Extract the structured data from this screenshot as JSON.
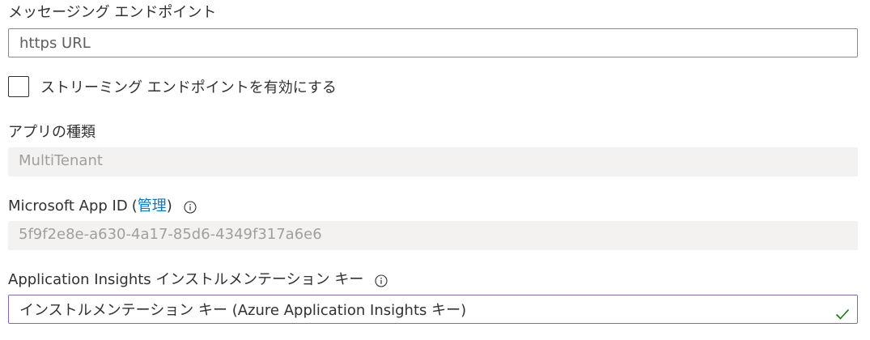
{
  "messaging_endpoint": {
    "label": "メッセージング エンドポイント",
    "placeholder": "https URL",
    "value": ""
  },
  "streaming_endpoint": {
    "label": "ストリーミング エンドポイントを有効にする",
    "checked": false
  },
  "app_type": {
    "label": "アプリの種類",
    "value": "MultiTenant"
  },
  "app_id": {
    "label": "Microsoft App ID",
    "paren_open": "(",
    "manage_link": "管理",
    "paren_close": ")",
    "value": "5f9f2e8e-a630-4a17-85d6-4349f317a6e6",
    "info_icon": "info-icon"
  },
  "app_insights": {
    "label": "Application Insights インストルメンテーション キー",
    "value": "インストルメンテーション キー (Azure Application Insights キー)",
    "info_icon": "info-icon",
    "valid_icon": "checkmark-icon"
  },
  "colors": {
    "link": "#0078d4",
    "focus_border": "#8764b8",
    "valid": "#107c10",
    "readonly_bg": "#f3f2f1"
  }
}
